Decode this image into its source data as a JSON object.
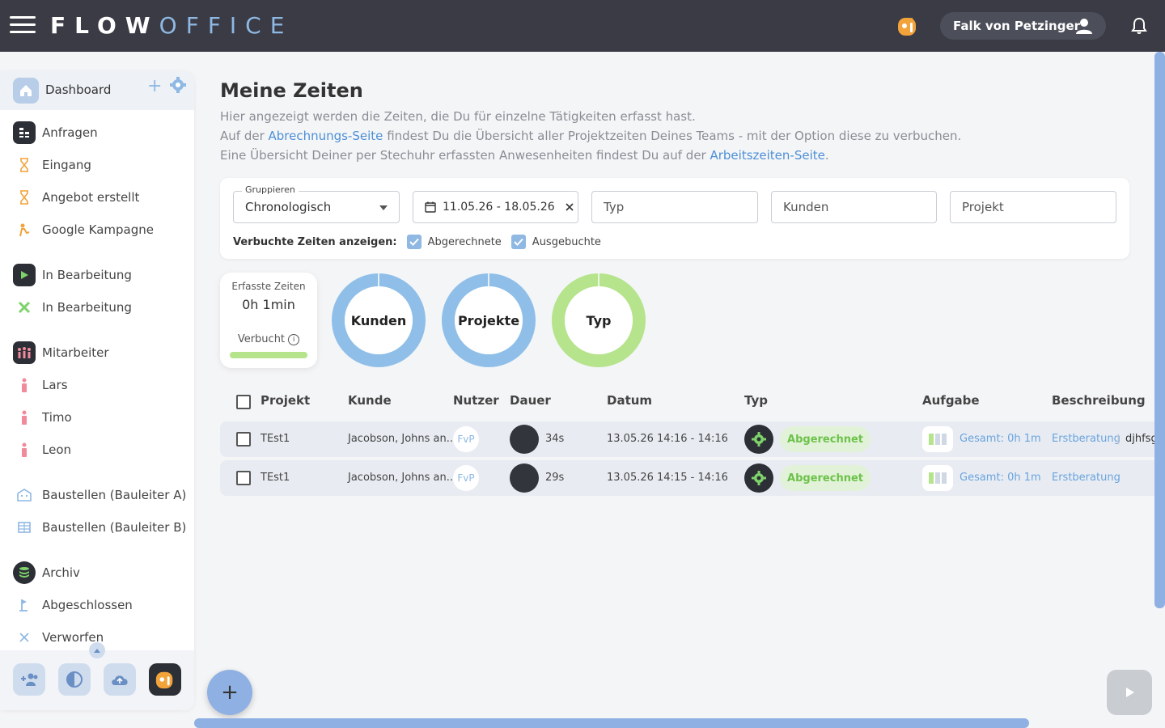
{
  "header": {
    "logo_bold": "FLOW",
    "logo_light": "OFFICE",
    "user_name": "Falk von Petzinger"
  },
  "sidebar": {
    "dashboard": "Dashboard",
    "items": [
      {
        "label": "Anfragen",
        "icon": "requests-icon"
      },
      {
        "label": "Eingang",
        "icon": "hourglass-icon"
      },
      {
        "label": "Angebot erstellt",
        "icon": "hourglass-icon"
      },
      {
        "label": "Google Kampagne",
        "icon": "person-icon"
      },
      {
        "label": "In Bearbeitung",
        "icon": "play-icon"
      },
      {
        "label": "In Bearbeitung",
        "icon": "tools-icon"
      },
      {
        "label": "Mitarbeiter",
        "icon": "people-icon"
      },
      {
        "label": "Lars",
        "icon": "person-icon"
      },
      {
        "label": "Timo",
        "icon": "person-icon"
      },
      {
        "label": "Leon",
        "icon": "person-icon"
      },
      {
        "label": "Baustellen (Bauleiter A)",
        "icon": "building-icon"
      },
      {
        "label": "Baustellen (Bauleiter B)",
        "icon": "table-icon"
      },
      {
        "label": "Archiv",
        "icon": "archive-icon"
      },
      {
        "label": "Abgeschlossen",
        "icon": "flag-icon"
      },
      {
        "label": "Verworfen",
        "icon": "close-icon"
      }
    ]
  },
  "main": {
    "title": "Meine Zeiten",
    "desc1": "Hier angezeigt werden die Zeiten, die Du für einzelne Tätigkeiten erfasst hast.",
    "desc2_a": "Auf der ",
    "desc2_link": "Abrechnungs-Seite",
    "desc2_b": " findest Du die Übersicht aller Projektzeiten Deines Teams - mit der Option diese zu verbuchen.",
    "desc3_a": "Eine Übersicht Deiner per Stechuhr erfassten Anwesenheiten findest Du auf der ",
    "desc3_link": "Arbeitszeiten-Seite",
    "desc3_b": "."
  },
  "filters": {
    "group_legend": "Gruppieren",
    "group_value": "Chronologisch",
    "date_range": "11.05.26 - 18.05.26",
    "typ_placeholder": "Typ",
    "kunden_placeholder": "Kunden",
    "projekt_placeholder": "Projekt",
    "verbuchte_label": "Verbuchte Zeiten anzeigen:",
    "cb1": "Abgerechnete",
    "cb2": "Ausgebuchte"
  },
  "stats": {
    "title": "Erfasste Zeiten",
    "value": "0h 1min",
    "verbucht": "Verbucht",
    "donuts": [
      "Kunden",
      "Projekte",
      "Typ"
    ]
  },
  "table": {
    "headers": [
      "Projekt",
      "Kunde",
      "Nutzer",
      "Dauer",
      "Datum",
      "Typ",
      "Aufgabe",
      "Beschreibung"
    ],
    "rows": [
      {
        "projekt": "TEst1",
        "kunde": "Jacobson, Johns an...",
        "nutzer": "FvP",
        "dauer": "34s",
        "datum": "13.05.26 14:16 - 14:16",
        "status": "Abgerechnet",
        "aufgabe": "Gesamt: 0h 1m",
        "beschreibung_link": "Erstberatung",
        "beschreibung": "djhfsg"
      },
      {
        "projekt": "TEst1",
        "kunde": "Jacobson, Johns an...",
        "nutzer": "FvP",
        "dauer": "29s",
        "datum": "13.05.26 14:15 - 14:16",
        "status": "Abgerechnet",
        "aufgabe": "Gesamt: 0h 1m",
        "beschreibung_link": "Erstberatung",
        "beschreibung": ""
      }
    ]
  },
  "colors": {
    "topbar": "#3a3b44",
    "accent": "#8fb8e3",
    "green": "#b5e48c",
    "link": "#4d8fd6"
  }
}
